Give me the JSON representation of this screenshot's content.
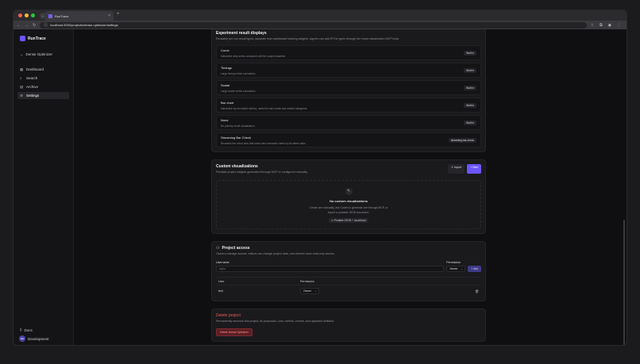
{
  "browser": {
    "tab_title": "RunTrace",
    "url": "localhost:3000/projects/dense-optimizer/settings"
  },
  "sidebar": {
    "brand": "RunTrace",
    "back_label": "Dense Optimizer",
    "items": [
      {
        "label": "Dashboard"
      },
      {
        "label": "Search"
      },
      {
        "label": "Archive"
      },
      {
        "label": "Settings"
      }
    ],
    "docs_label": "Docs",
    "user_initials": "DE",
    "user_name": "Development"
  },
  "result_displays": {
    "title": "Experiment result displays",
    "subtitle": "Reusable per-run result types, separate from dashboard tracking widgets. Agents can add RTViz types through the result visualization MCP tools.",
    "rows": [
      {
        "name": "Curve",
        "desc": "Interactive step series compared with the project baseline.",
        "badge": "Built in"
      },
      {
        "name": "Timings",
        "desc": "Large timing metric summaries.",
        "badge": "Built in"
      },
      {
        "name": "Scalar",
        "desc": "Large scalar metric summaries.",
        "badge": "Built in"
      },
      {
        "name": "Bar chart",
        "desc": "Interactive top-ten latest metrics, useful for call counts and ranked categories.",
        "badge": "Built in"
      },
      {
        "name": "None",
        "desc": "No primary result visualization.",
        "badge": "Built in"
      },
      {
        "name": "Streaming Bar Check",
        "desc": "Reusable live result view that ranks each streamed metric by its latest value.",
        "badge": "streaming-bar-check"
      }
    ]
  },
  "custom_viz": {
    "title": "Custom visualizations",
    "subtitle": "Portable project widgets generated through MCP or configured manually.",
    "import_label": "Import",
    "new_label": "+ New",
    "empty_title": "No custom visualizations",
    "empty_desc": "Create one manually, ask Codex to generate one through MCP, or import a portable JSON document.",
    "empty_tag": "Portable JSON + JavaScript"
  },
  "project_access": {
    "title": "Project access",
    "subtitle": "Owners manage access, editors can change project data, and viewers have read-only access.",
    "username_label": "Username",
    "username_placeholder": "taylor",
    "permission_label": "Permission",
    "permission_value": "Viewer",
    "add_label": "+ Add",
    "columns": [
      "User",
      "Permission"
    ],
    "rows": [
      {
        "user": "test",
        "permission": "Owner"
      }
    ]
  },
  "delete_project": {
    "title": "Delete project",
    "subtitle": "Permanently removes this project, its proposals, runs, metrics, events, and uploaded artifacts.",
    "button_label": "Delete Dense Optimizer"
  },
  "colors": {
    "accent": "#6b56ff",
    "danger": "#ee5b5b"
  }
}
